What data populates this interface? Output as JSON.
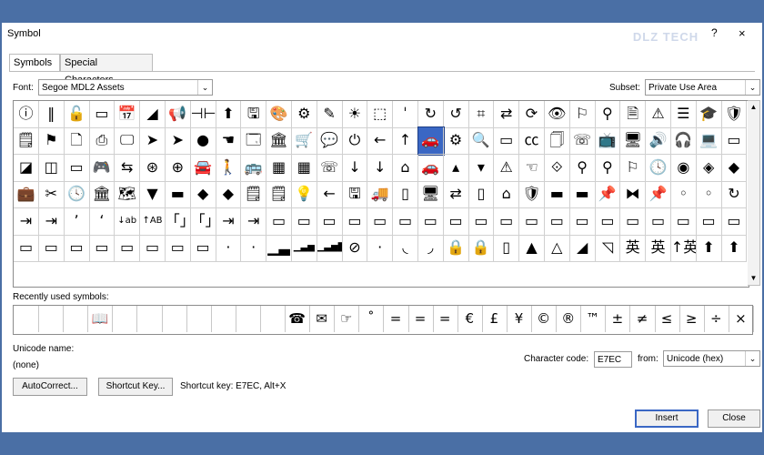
{
  "dialog": {
    "title": "Symbol",
    "help": "?",
    "close_glyph": "×",
    "watermark": "DLZ TECH"
  },
  "tabs": [
    {
      "label": "Symbols",
      "active": true
    },
    {
      "label": "Special Characters",
      "active": false
    }
  ],
  "font": {
    "label": "Font:",
    "value": "Segoe MDL2 Assets"
  },
  "subset": {
    "label": "Subset:",
    "value": "Private Use Area"
  },
  "grid_rows": [
    [
      "ⓘ",
      "‖",
      "🔓",
      "▭",
      "📅",
      "◢",
      "📢",
      "⊣⊢",
      "⬆",
      "🖫",
      "🎨",
      "⚙",
      "✎",
      "☀",
      "⬚",
      "ˈ",
      "↻",
      "↺",
      "⌗",
      "⇄",
      "⟳",
      "👁",
      "⚐",
      "⚲",
      "🗎",
      "⚠",
      "☰",
      "🎓",
      "🛡"
    ],
    [
      "🗒",
      "⚑",
      "🗋",
      "⎙",
      "🖵",
      "➤",
      "➤",
      "●",
      "☚",
      "🗔",
      "🏛",
      "🛒",
      "💬",
      "⏻",
      "←",
      "↑",
      "🚗",
      "⚙",
      "🔍",
      "▭",
      "㏄",
      "🗍",
      "☏",
      "📺",
      "🖥",
      "🔊",
      "🎧",
      "💻",
      "▭"
    ],
    [
      "◪",
      "◫",
      "▭",
      "🎮",
      "⇆",
      "⊛",
      "⊕",
      "🚘",
      "🚶",
      "🚌",
      "▦",
      "▦",
      "☏",
      "↓",
      "↓",
      "⌂",
      "🚗",
      "▴",
      "▾",
      "⚠",
      "☜",
      "⟐",
      "⚲",
      "⚲",
      "⚐",
      "🕓",
      "◉",
      "◈",
      "◆"
    ],
    [
      "💼",
      "✂",
      "🕓",
      "🏛",
      "🗺",
      "▼",
      "▬",
      "◆",
      "◆",
      "🗒",
      "🗒",
      "💡",
      "←",
      "🖫",
      "🚚",
      "▯",
      "🖥",
      "⇄",
      "▯",
      "⌂",
      "🛡",
      "▬",
      "▬",
      "📌",
      "⧓",
      "📌",
      "◦",
      "◦",
      "↻"
    ],
    [
      "⇥",
      "⇥",
      "ʼ",
      "ʻ",
      "↓ab",
      "↑AB",
      "「」",
      "「」",
      "⇥",
      "⇥",
      "▭",
      "▭",
      "▭",
      "▭",
      "▭",
      "▭",
      "▭",
      "▭",
      "▭",
      "▭",
      "▭",
      "▭",
      "▭",
      "▭",
      "▭",
      "▭",
      "▭",
      "▭",
      "▭"
    ],
    [
      "▭",
      "▭",
      "▭",
      "▭",
      "▭",
      "▭",
      "▭",
      "▭",
      "·",
      "·",
      "▁▃",
      "▁▃▅",
      "▁▃▅▇",
      "⊘",
      "·",
      "◟",
      "◞",
      "🔒",
      "🔒",
      "▯",
      "▲",
      "△",
      "◢",
      "◹",
      "英",
      "英",
      "↑英",
      "⬆",
      "⬆"
    ]
  ],
  "selected_code": "E7EC",
  "recent": {
    "label": "Recently used symbols:",
    "symbols": [
      "",
      "",
      "",
      "📖",
      "",
      "",
      "",
      "",
      "",
      "",
      "",
      "☎",
      "✉",
      "☞",
      "˚",
      "=",
      "=",
      "=",
      "€",
      "£",
      "¥",
      "©",
      "®",
      "™",
      "±",
      "≠",
      "≤",
      "≥",
      "÷",
      "×"
    ]
  },
  "unicode_name": {
    "label": "Unicode name:",
    "value": "(none)"
  },
  "char_code": {
    "label": "Character code:",
    "value": "E7EC"
  },
  "from": {
    "label": "from:",
    "value": "Unicode (hex)"
  },
  "buttons": {
    "autocorrect": "AutoCorrect...",
    "shortcut_key": "Shortcut Key...",
    "insert": "Insert",
    "close": "Close"
  },
  "shortcut_text": "Shortcut key: E7EC, Alt+X",
  "scroll_up": "▲",
  "scroll_down": "▼",
  "dropdown_arrow": "⌄",
  "selected_color": "#3a67c4"
}
